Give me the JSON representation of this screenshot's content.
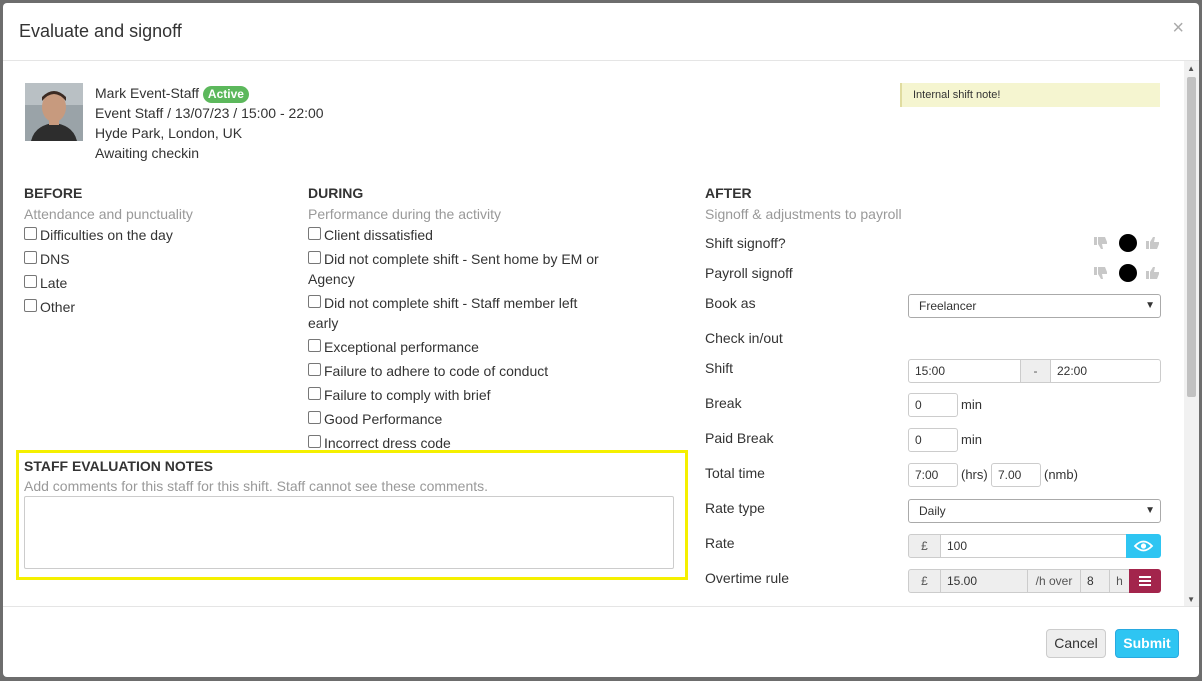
{
  "modal": {
    "title": "Evaluate and signoff",
    "close_glyph": "×"
  },
  "staff": {
    "name": "Mark Event-Staff",
    "status": "Active",
    "role_line": "Event Staff / 13/07/23 / 15:00 - 22:00",
    "location": "Hyde Park, London, UK",
    "checkin_status": "Awaiting checkin"
  },
  "shift_note": "Internal shift note!",
  "before": {
    "title": "BEFORE",
    "subtitle": "Attendance and punctuality",
    "items": [
      "Difficulties on the day",
      "DNS",
      "Late",
      "Other"
    ]
  },
  "during": {
    "title": "DURING",
    "subtitle": "Performance during the activity",
    "items": [
      "Client dissatisfied",
      "Did not complete shift - Sent home by EM or Agency",
      "Did not complete shift - Staff member left early",
      "Exceptional performance",
      "Failure to adhere to code of conduct",
      "Failure to comply with brief",
      "Good Performance",
      "Incorrect dress code"
    ]
  },
  "notes": {
    "title": "STAFF EVALUATION NOTES",
    "subtitle": "Add comments for this staff for this shift. Staff cannot see these comments.",
    "value": ""
  },
  "after": {
    "title": "AFTER",
    "subtitle": "Signoff & adjustments to payroll",
    "shift_signoff_label": "Shift signoff?",
    "payroll_signoff_label": "Payroll signoff",
    "book_as_label": "Book as",
    "book_as_value": "Freelancer",
    "checkin_label": "Check in/out",
    "shift_label": "Shift",
    "shift_start": "15:00",
    "shift_sep": "-",
    "shift_end": "22:00",
    "break_label": "Break",
    "break_value": "0",
    "break_unit": "min",
    "paid_break_label": "Paid Break",
    "paid_break_value": "0",
    "paid_break_unit": "min",
    "total_time_label": "Total time",
    "total_hrs": "7:00",
    "hrs_unit": "(hrs)",
    "total_nmb": "7.00",
    "nmb_unit": "(nmb)",
    "rate_type_label": "Rate type",
    "rate_type_value": "Daily",
    "rate_label": "Rate",
    "currency": "£",
    "rate_value": "100",
    "overtime_label": "Overtime rule",
    "overtime_rate": "15.00",
    "overtime_per": "/h over",
    "overtime_hours": "8",
    "overtime_unit": "h"
  },
  "footer": {
    "cancel": "Cancel",
    "submit": "Submit"
  },
  "colors": {
    "highlight": "#f5f000",
    "primary": "#2ec5f2",
    "danger": "#a3254c",
    "active_badge": "#5cb85c"
  }
}
